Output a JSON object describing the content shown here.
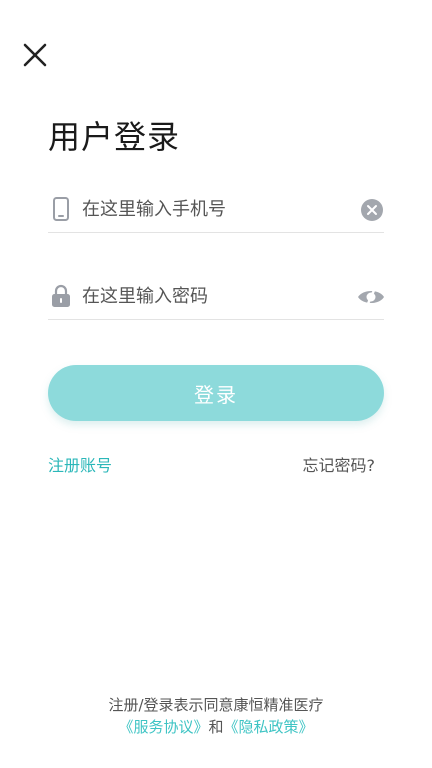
{
  "header": {
    "title": "用户登录",
    "close_icon": "close-icon"
  },
  "form": {
    "phone": {
      "placeholder": "在这里输入手机号",
      "value": "",
      "lead_icon": "phone-icon",
      "trail_icon": "clear-icon"
    },
    "password": {
      "placeholder": "在这里输入密码",
      "value": "",
      "lead_icon": "lock-icon",
      "trail_icon": "eye-hidden-icon"
    },
    "login_label": "登录"
  },
  "links": {
    "register": "注册账号",
    "forgot": "忘记密码?"
  },
  "agreement": {
    "line1": "注册/登录表示同意康恒精准医疗",
    "terms": "《服务协议》",
    "and": "和",
    "privacy": "《隐私政策》"
  },
  "colors": {
    "accent": "#8ddadb",
    "link": "#2bb7b9",
    "icon_gray": "#9a9ea6"
  }
}
